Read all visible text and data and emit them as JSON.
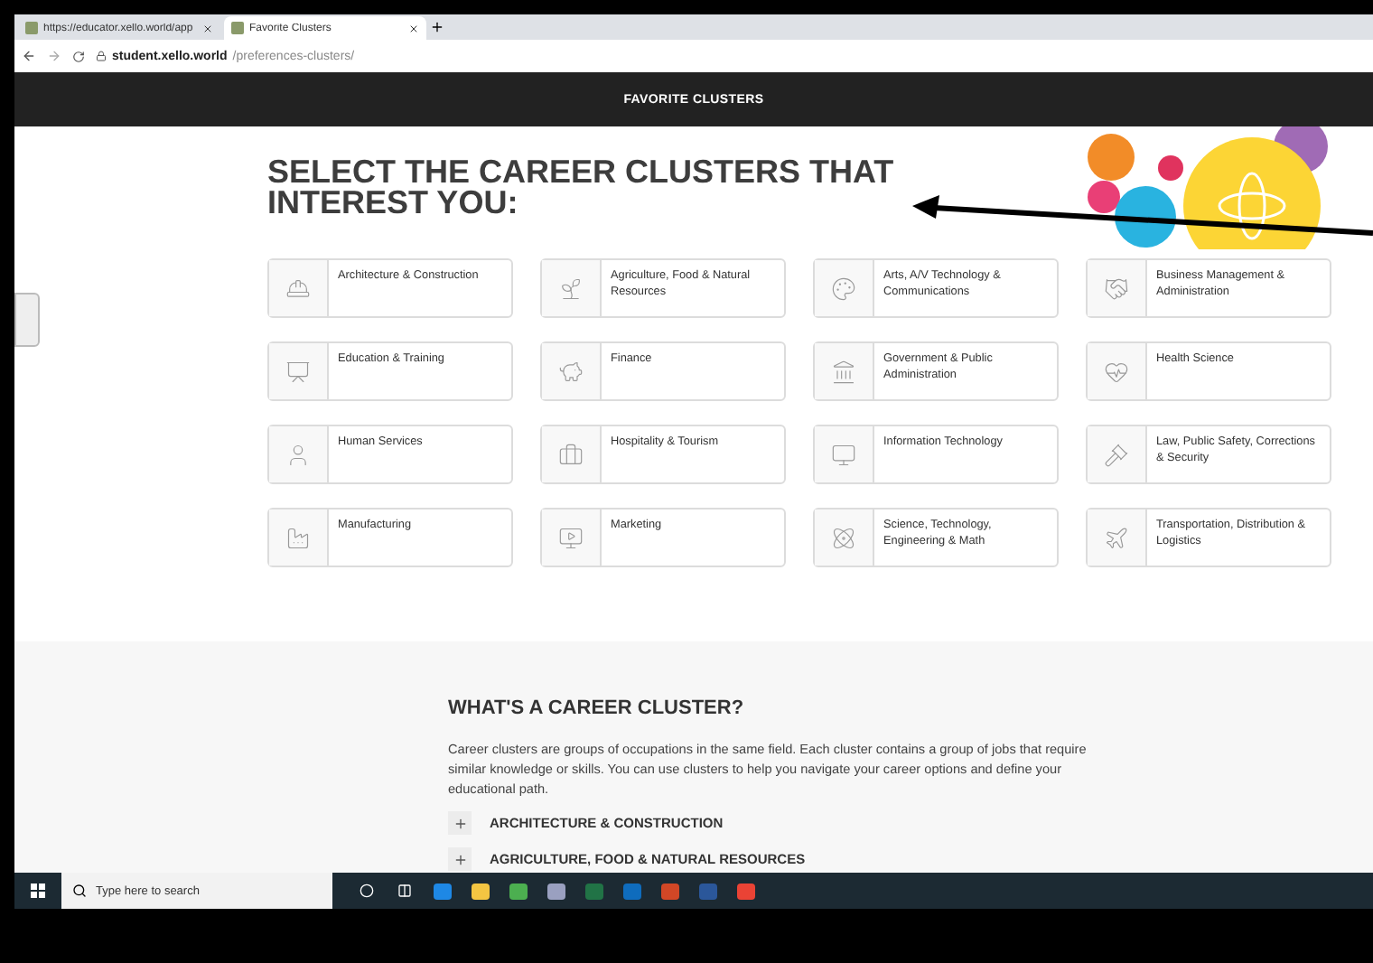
{
  "browser": {
    "tabs": [
      {
        "title": "https://educator.xello.world/app",
        "selected": false
      },
      {
        "title": "Favorite Clusters",
        "selected": true
      }
    ],
    "url_host": "student.xello.world",
    "url_path": "/preferences-clusters/"
  },
  "header": {
    "title": "FAVORITE CLUSTERS"
  },
  "heading": "SELECT THE CAREER CLUSTERS THAT INTEREST YOU:",
  "clusters": [
    {
      "label": "Architecture & Construction"
    },
    {
      "label": "Agriculture, Food & Natural Resources"
    },
    {
      "label": "Arts, A/V Technology & Communications"
    },
    {
      "label": "Business Management & Administration"
    },
    {
      "label": "Education & Training"
    },
    {
      "label": "Finance"
    },
    {
      "label": "Government & Public Administration"
    },
    {
      "label": "Health Science"
    },
    {
      "label": "Human Services"
    },
    {
      "label": "Hospitality & Tourism"
    },
    {
      "label": "Information Technology"
    },
    {
      "label": "Law, Public Safety, Corrections & Security"
    },
    {
      "label": "Manufacturing"
    },
    {
      "label": "Marketing"
    },
    {
      "label": "Science, Technology, Engineering & Math"
    },
    {
      "label": "Transportation, Distribution & Logistics"
    }
  ],
  "info": {
    "title": "WHAT'S A CAREER CLUSTER?",
    "text": "Career clusters are groups of occupations in the same field. Each cluster contains a group of jobs that require similar knowledge or skills. You can use clusters to help you navigate your career options and define your educational path.",
    "items": [
      {
        "label": "ARCHITECTURE & CONSTRUCTION",
        "expanded": false
      },
      {
        "label": "AGRICULTURE, FOOD & NATURAL RESOURCES",
        "expanded": false
      }
    ]
  },
  "taskbar": {
    "search": {
      "placeholder": "Type here to search"
    }
  }
}
